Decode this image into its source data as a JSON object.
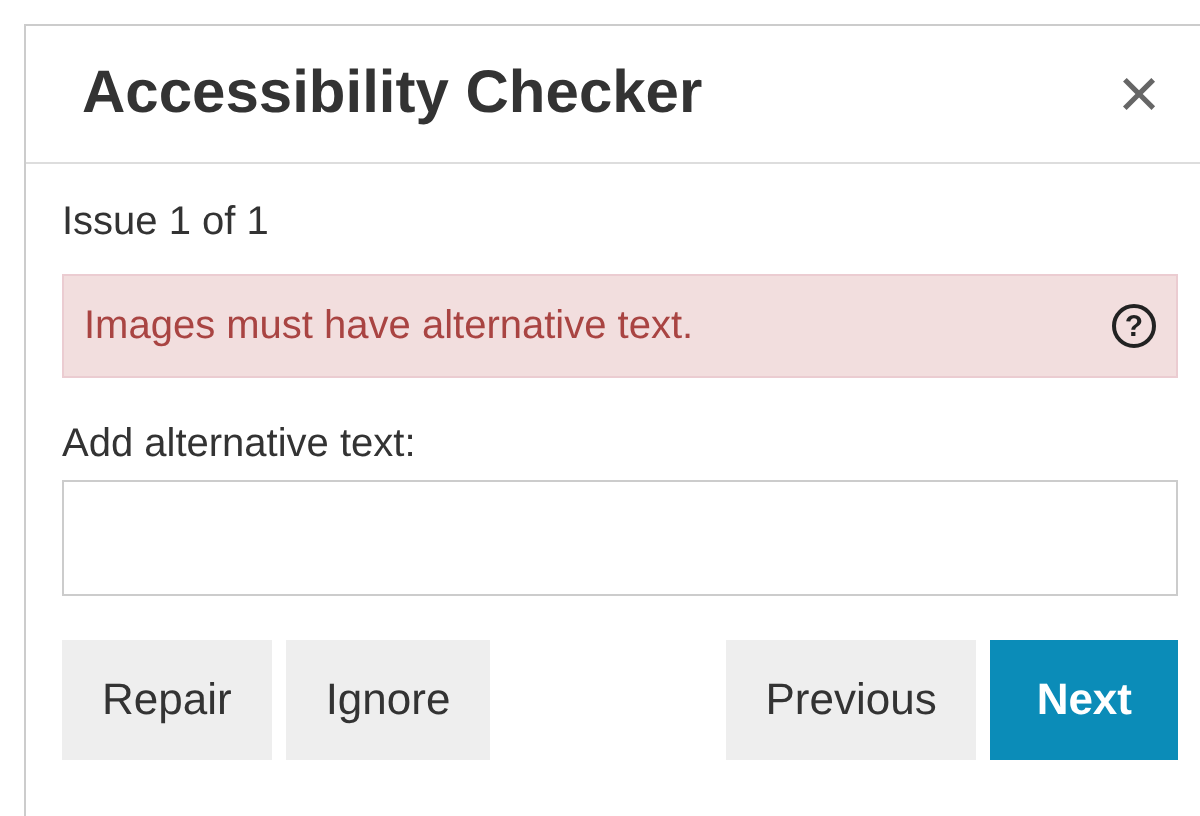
{
  "dialog": {
    "title": "Accessibility Checker",
    "close": "×"
  },
  "issue_counter": "Issue 1 of 1",
  "issue": {
    "message": "Images must have alternative text.",
    "help": "?"
  },
  "field": {
    "label": "Add alternative text:"
  },
  "buttons": [
    {
      "label": "Repair",
      "kind": "default"
    },
    {
      "label": "Ignore",
      "kind": "default"
    },
    {
      "label": "Previous",
      "kind": "default"
    },
    {
      "label": "Next",
      "kind": "primary"
    }
  ]
}
